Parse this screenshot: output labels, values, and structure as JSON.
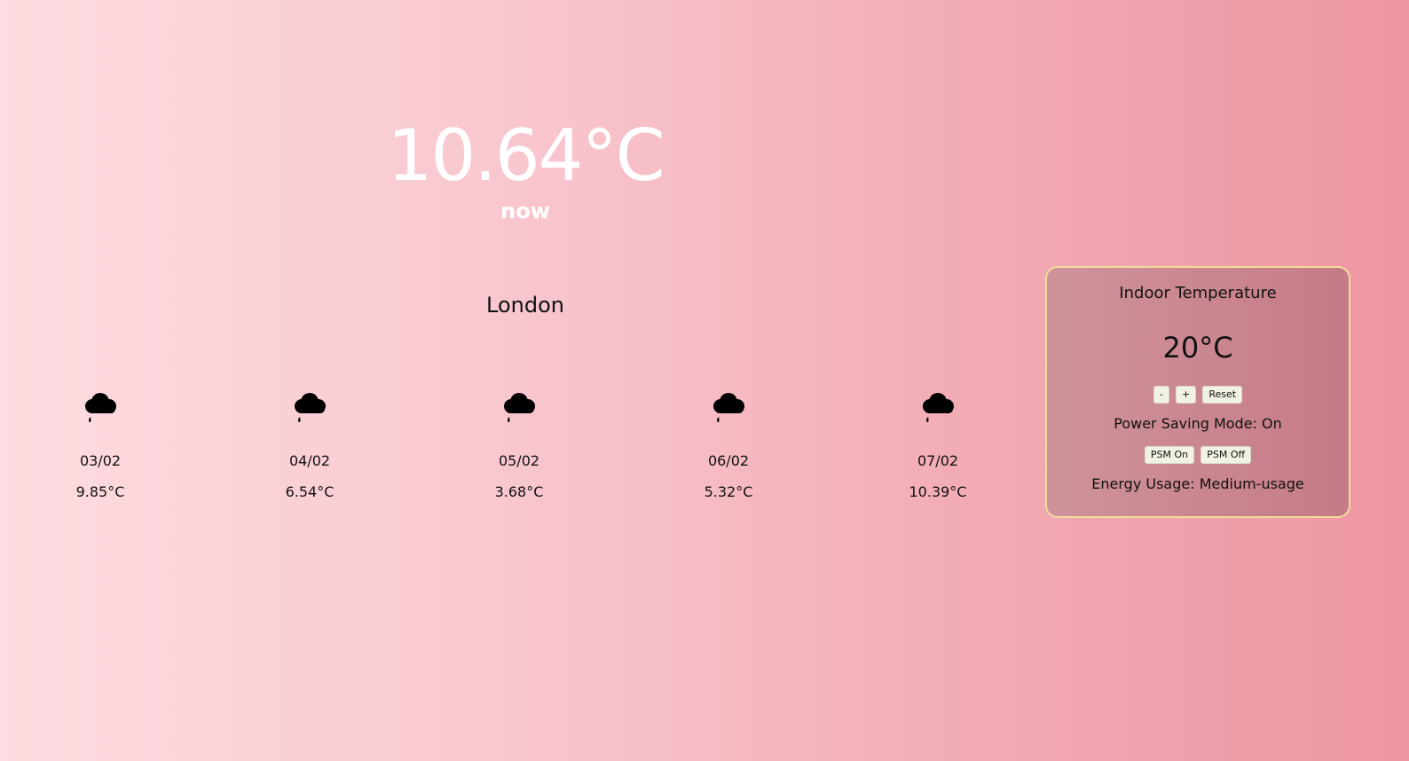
{
  "current": {
    "temperature": "10.64°C",
    "label": "now",
    "city": "London"
  },
  "forecast": [
    {
      "icon": "rain-cloud-icon",
      "date": "03/02",
      "temp": "9.85°C"
    },
    {
      "icon": "rain-cloud-icon",
      "date": "04/02",
      "temp": "6.54°C"
    },
    {
      "icon": "rain-cloud-icon",
      "date": "05/02",
      "temp": "3.68°C"
    },
    {
      "icon": "rain-cloud-icon",
      "date": "06/02",
      "temp": "5.32°C"
    },
    {
      "icon": "rain-cloud-icon",
      "date": "07/02",
      "temp": "10.39°C"
    }
  ],
  "indoor": {
    "title": "Indoor Temperature",
    "temperature": "20°C",
    "decrease_label": "-",
    "increase_label": "+",
    "reset_label": "Reset",
    "power_saving_text": "Power Saving Mode: On",
    "psm_on_label": "PSM On",
    "psm_off_label": "PSM Off",
    "energy_usage_text": "Energy Usage: Medium-usage"
  },
  "colors": {
    "gradient_start": "#fddde1",
    "gradient_end": "#ed96a1",
    "panel_border": "#f1dc9c",
    "current_text": "#ffffff"
  }
}
